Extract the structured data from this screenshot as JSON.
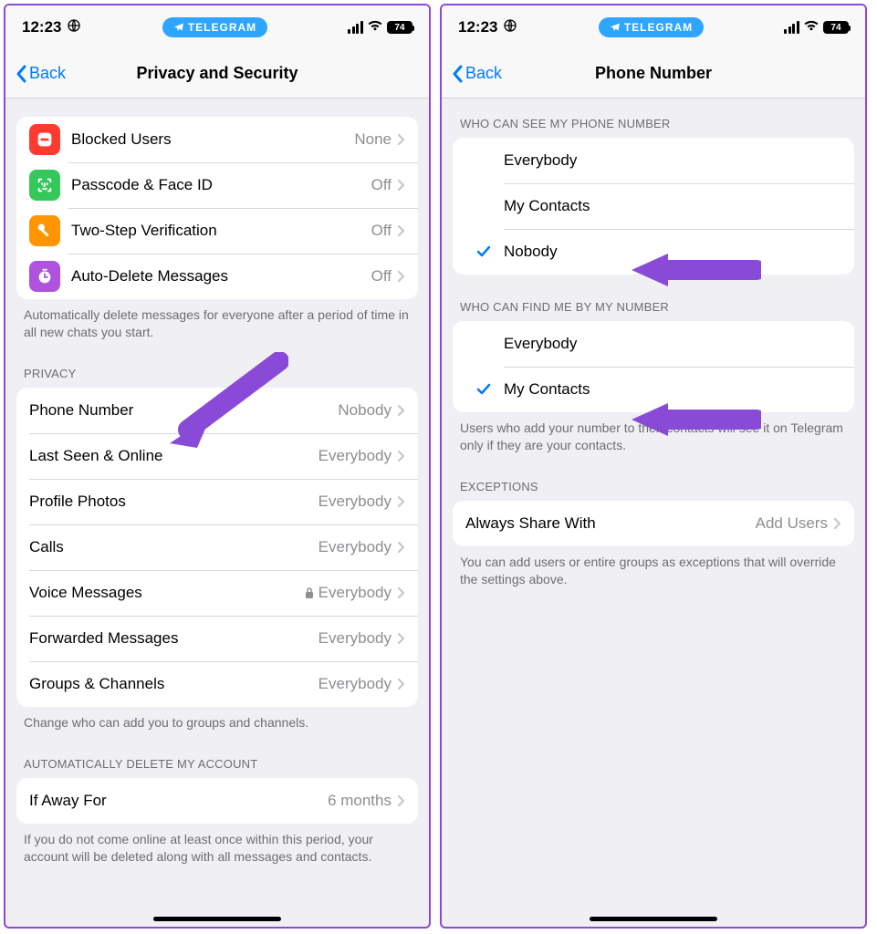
{
  "status": {
    "time": "12:23",
    "pill": "TELEGRAM",
    "battery": "74"
  },
  "nav": {
    "back": "Back"
  },
  "left": {
    "title": "Privacy and Security",
    "security": [
      {
        "label": "Blocked Users",
        "value": "None"
      },
      {
        "label": "Passcode & Face ID",
        "value": "Off"
      },
      {
        "label": "Two-Step Verification",
        "value": "Off"
      },
      {
        "label": "Auto-Delete Messages",
        "value": "Off"
      }
    ],
    "security_footer": "Automatically delete messages for everyone after a period of time in all new chats you start.",
    "privacy_header": "PRIVACY",
    "privacy": [
      {
        "label": "Phone Number",
        "value": "Nobody"
      },
      {
        "label": "Last Seen & Online",
        "value": "Everybody"
      },
      {
        "label": "Profile Photos",
        "value": "Everybody"
      },
      {
        "label": "Calls",
        "value": "Everybody"
      },
      {
        "label": "Voice Messages",
        "value": "Everybody",
        "locked": true
      },
      {
        "label": "Forwarded Messages",
        "value": "Everybody"
      },
      {
        "label": "Groups & Channels",
        "value": "Everybody"
      }
    ],
    "privacy_footer": "Change who can add you to groups and channels.",
    "auto_header": "AUTOMATICALLY DELETE MY ACCOUNT",
    "auto": {
      "label": "If Away For",
      "value": "6 months"
    },
    "auto_footer": "If you do not come online at least once within this period, your account will be deleted along with all messages and contacts."
  },
  "right": {
    "title": "Phone Number",
    "see_header": "WHO CAN SEE MY PHONE NUMBER",
    "see": [
      {
        "label": "Everybody",
        "checked": false
      },
      {
        "label": "My Contacts",
        "checked": false
      },
      {
        "label": "Nobody",
        "checked": true
      }
    ],
    "find_header": "WHO CAN FIND ME BY MY NUMBER",
    "find": [
      {
        "label": "Everybody",
        "checked": false
      },
      {
        "label": "My Contacts",
        "checked": true
      }
    ],
    "find_footer": "Users who add your number to their contacts will see it on Telegram only if they are your contacts.",
    "exc_header": "EXCEPTIONS",
    "exc": {
      "label": "Always Share With",
      "value": "Add Users"
    },
    "exc_footer": "You can add users or entire groups as exceptions that will override the settings above."
  }
}
